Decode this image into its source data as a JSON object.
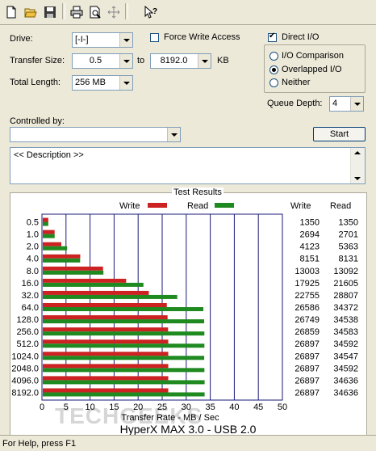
{
  "toolbar": {
    "buttons": [
      "new-icon",
      "open-icon",
      "save-icon",
      "print-icon",
      "print-preview-icon",
      "move-icon",
      "help-pointer-icon"
    ]
  },
  "form": {
    "drive_label": "Drive:",
    "drive_value": "[-I-]",
    "transfer_size_label": "Transfer Size:",
    "transfer_from": "0.5",
    "to_label": "to",
    "transfer_to": "8192.0",
    "kb_label": "KB",
    "total_length_label": "Total Length:",
    "total_length_value": "256 MB",
    "force_write_access_label": "Force Write Access",
    "force_write_access_checked": false,
    "direct_io_label": "Direct I/O",
    "direct_io_checked": true,
    "io_comparison_label": "I/O Comparison",
    "overlapped_io_label": "Overlapped I/O",
    "neither_label": "Neither",
    "selected_mode": "overlapped",
    "queue_depth_label": "Queue Depth:",
    "queue_depth_value": "4",
    "controlled_by_label": "Controlled by:",
    "controlled_by_value": "",
    "start_label": "Start",
    "description_text": "<< Description >>"
  },
  "results": {
    "title": "Test Results",
    "legend_write": "Write",
    "legend_read": "Read",
    "col_write": "Write",
    "col_read": "Read"
  },
  "colors": {
    "write": "#cc2222",
    "read": "#1f8a1f",
    "grid": "#1a1a7a"
  },
  "chart_data": {
    "type": "bar",
    "categories": [
      "0.5",
      "1.0",
      "2.0",
      "4.0",
      "8.0",
      "16.0",
      "32.0",
      "64.0",
      "128.0",
      "256.0",
      "512.0",
      "1024.0",
      "2048.0",
      "4096.0",
      "8192.0"
    ],
    "series": [
      {
        "name": "Write",
        "values": [
          1350,
          2694,
          4123,
          8151,
          13003,
          17925,
          22755,
          26586,
          26749,
          26859,
          26897,
          26897,
          26897,
          26897,
          26897
        ]
      },
      {
        "name": "Read",
        "values": [
          1350,
          2701,
          5363,
          8131,
          13092,
          21605,
          28807,
          34372,
          34538,
          34583,
          34592,
          34547,
          34592,
          34636,
          34636
        ]
      }
    ],
    "xticks": [
      "0",
      "5",
      "10",
      "15",
      "20",
      "25",
      "30",
      "35",
      "40",
      "45",
      "50"
    ],
    "xlim": [
      0,
      50
    ],
    "xlabel": "Transfer Rate - MB / Sec",
    "grid": true,
    "legend": "top"
  },
  "caption": "HyperX MAX 3.0 - USB 2.0",
  "watermark": "TECHGEEKS",
  "status_text": "For Help, press F1"
}
